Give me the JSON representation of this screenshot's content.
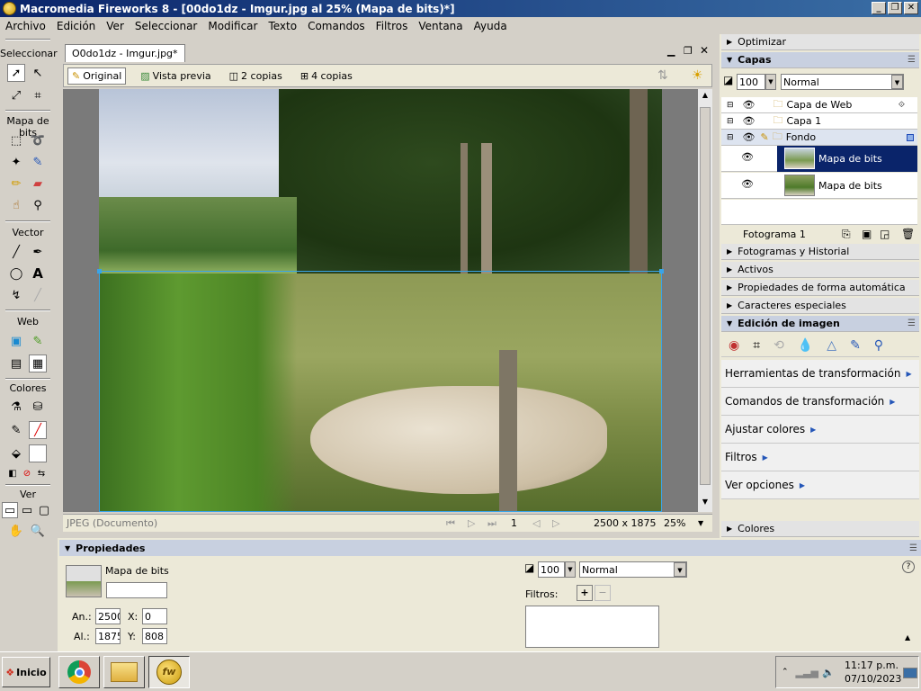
{
  "window": {
    "title": "Macromedia Fireworks 8 - [00do1dz - Imgur.jpg al  25% (Mapa de bits)*]"
  },
  "menu": [
    "Archivo",
    "Edición",
    "Ver",
    "Seleccionar",
    "Modificar",
    "Texto",
    "Comandos",
    "Filtros",
    "Ventana",
    "Ayuda"
  ],
  "tools": {
    "sections": [
      "Seleccionar",
      "Mapa de bits",
      "Vector",
      "Web",
      "Colores",
      "Ver"
    ]
  },
  "document": {
    "tab": "O0do1dz - Imgur.jpg*",
    "views": [
      "Original",
      "Vista previa",
      "2 copias",
      "4 copias"
    ],
    "status_type": "JPEG (Documento)",
    "frame": "1",
    "size": "2500 x 1875",
    "zoom": "25%"
  },
  "panels": {
    "optimizar": "Optimizar",
    "capas": {
      "title": "Capas",
      "opacity": "100",
      "blend": "Normal",
      "layers": [
        "Capa de Web",
        "Capa 1",
        "Fondo"
      ],
      "objects": [
        "Mapa de bits",
        "Mapa de bits"
      ],
      "frame": "Fotograma 1"
    },
    "collapsed": [
      "Fotogramas y Historial",
      "Activos",
      "Propiedades de forma automática",
      "Caracteres especiales"
    ],
    "edicion": {
      "title": "Edición de imagen",
      "commands": [
        "Herramientas de transformación",
        "Comandos de transformación",
        "Ajustar colores",
        "Filtros",
        "Ver opciones"
      ]
    },
    "colores": "Colores"
  },
  "properties": {
    "title": "Propiedades",
    "object_type": "Mapa de bits",
    "width_label": "An.:",
    "height_label": "Al.:",
    "width": "2500",
    "height": "1875",
    "x_label": "X:",
    "y_label": "Y:",
    "x": "0",
    "y": "808",
    "opacity": "100",
    "blend": "Normal",
    "filters_label": "Filtros:"
  },
  "taskbar": {
    "start": "Inicio",
    "time": "11:17 p.m.",
    "date": "07/10/2023"
  }
}
